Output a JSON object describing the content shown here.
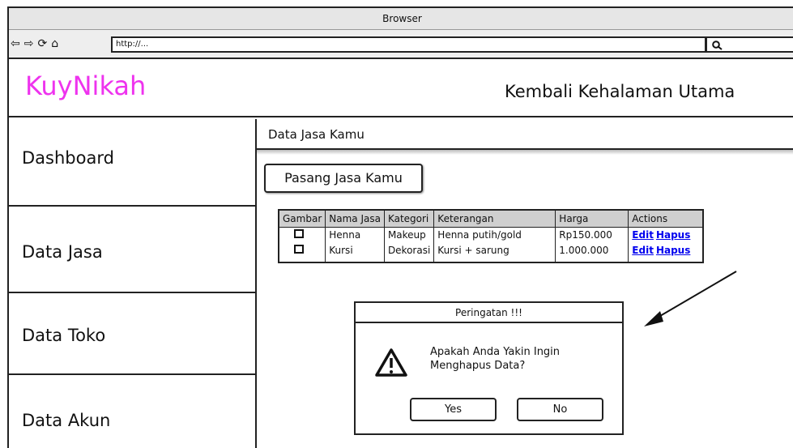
{
  "browser": {
    "title": "Browser",
    "url": "http://...",
    "nav_icons": [
      "back-icon",
      "forward-icon",
      "reload-icon",
      "home-icon"
    ],
    "search_icon": "search-icon"
  },
  "header": {
    "brand": "KuyNikah",
    "back_link": "Kembali Kehalaman Utama",
    "brand_color": "#ee33ee"
  },
  "sidebar": {
    "items": [
      {
        "label": "Dashboard"
      },
      {
        "label": "Data Jasa"
      },
      {
        "label": "Data Toko"
      },
      {
        "label": "Data Akun"
      }
    ]
  },
  "main": {
    "title": "Data Jasa Kamu",
    "add_button": "Pasang Jasa Kamu",
    "table": {
      "columns": [
        "Gambar",
        "Nama Jasa",
        "Kategori",
        "Keterangan",
        "Harga",
        "Actions"
      ],
      "rows": [
        {
          "nama": "Henna",
          "kategori": "Makeup",
          "keterangan": "Henna putih/gold",
          "harga": "Rp150.000",
          "edit": "Edit",
          "hapus": "Hapus"
        },
        {
          "nama": "Kursi",
          "kategori": "Dekorasi",
          "keterangan": "Kursi + sarung",
          "harga": "1.000.000",
          "edit": "Edit",
          "hapus": "Hapus"
        }
      ]
    }
  },
  "dialog": {
    "title": "Peringatan !!!",
    "message_line1": "Apakah Anda Yakin Ingin",
    "message_line2": "Menghapus Data?",
    "icon": "warning-icon",
    "yes": "Yes",
    "no": "No"
  }
}
